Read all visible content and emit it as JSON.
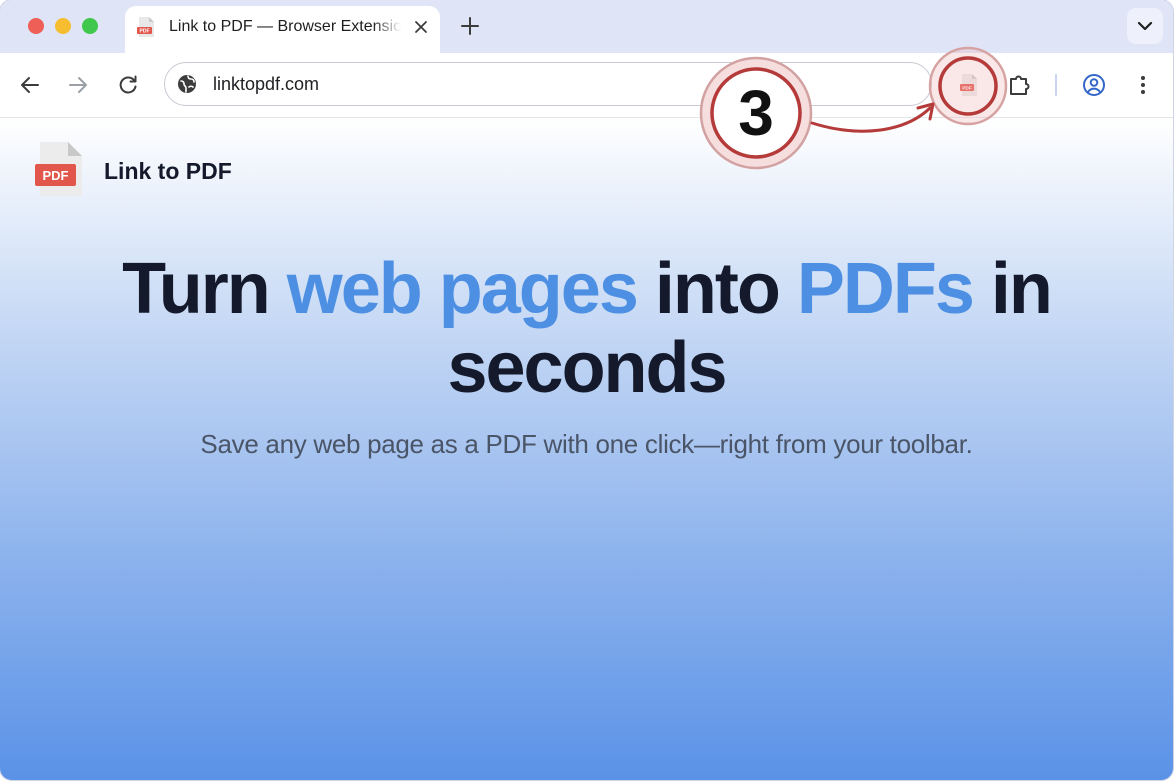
{
  "browser": {
    "tab_title": "Link to PDF — Browser Extension",
    "address": "linktopdf.com",
    "icons": {
      "back": "back-arrow-icon",
      "forward": "forward-arrow-icon",
      "reload": "reload-icon",
      "site_info": "globe-icon",
      "extension": "pdf-extension-icon",
      "extensions_menu": "puzzle-icon",
      "profile": "profile-icon",
      "menu": "kebab-menu-icon",
      "new_tab": "plus-icon",
      "close_tab": "close-icon",
      "tab_search": "chevron-down-icon"
    }
  },
  "page": {
    "brand_name": "Link to PDF",
    "logo_label": "PDF",
    "hero": {
      "part1": "Turn ",
      "accent1": "web pages",
      "part2": " into ",
      "accent2": "PDFs",
      "part3": " in seconds"
    },
    "subtitle": "Save any web page as a PDF with one click—right from your toolbar."
  },
  "annotation": {
    "step": "3"
  },
  "colors": {
    "accent_blue": "#4d8fe3",
    "heading": "#141a2b",
    "pdf_red": "#e2574c",
    "annotation_red": "#b53a3a"
  }
}
